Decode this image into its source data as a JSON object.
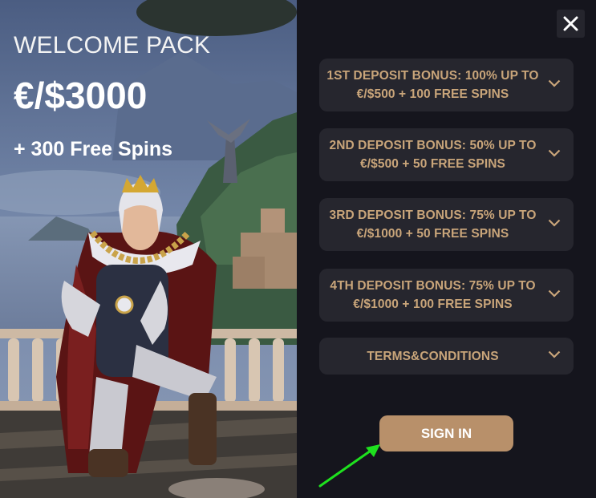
{
  "promo": {
    "title": "WELCOME PACK",
    "amount": "€/$3000",
    "spins": "+ 300 Free Spins"
  },
  "modal": {
    "close_icon": "close-icon",
    "accordion": [
      {
        "label": "1ST DEPOSIT BONUS: 100% UP TO €/$500 + 100 FREE SPINS",
        "line1": "1ST DEPOSIT BONUS: 100% UP TO",
        "line2": "€/$500 + 100 FREE SPINS"
      },
      {
        "label": "2ND DEPOSIT BONUS: 50% UP TO €/$500 + 50 FREE SPINS",
        "line1": "2ND DEPOSIT BONUS: 50% UP TO",
        "line2": "€/$500 + 50 FREE SPINS"
      },
      {
        "label": "3RD DEPOSIT BONUS: 75% UP TO €/$1000 + 50 FREE SPINS",
        "line1": "3RD DEPOSIT BONUS: 75% UP TO",
        "line2": "€/$1000 + 50 FREE SPINS"
      },
      {
        "label": "4TH DEPOSIT BONUS: 75% UP TO €/$1000 + 100 FREE SPINS",
        "line1": "4TH DEPOSIT BONUS: 75% UP TO",
        "line2": "€/$1000 + 100 FREE SPINS"
      },
      {
        "label": "TERMS&CONDITIONS",
        "line1": "TERMS&CONDITIONS",
        "line2": ""
      }
    ],
    "sign_in_label": "SIGN IN"
  },
  "colors": {
    "panel_bg": "#15151d",
    "accordion_bg": "#26262e",
    "accent_text": "#c9a57a",
    "button_bg": "#b8906a",
    "arrow_annotation": "#1ee11e"
  }
}
